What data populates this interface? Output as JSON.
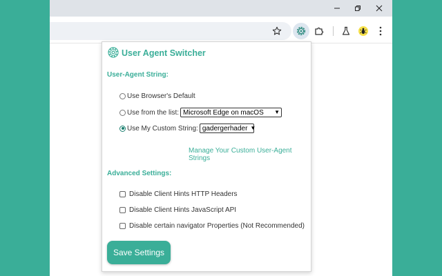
{
  "colors": {
    "accent": "#3aae98",
    "background": "#3aae98"
  },
  "browser": {
    "controls": [
      "minimize-icon",
      "restore-icon",
      "close-icon"
    ],
    "toolbar_icons": [
      "star-icon",
      "gear-icon",
      "puzzle-icon",
      "flask-icon",
      "bug-icon",
      "kebab-menu-icon"
    ]
  },
  "popup": {
    "title": "User Agent Switcher",
    "ua_section": "User-Agent String:",
    "options": {
      "default_label": "Use Browser's Default",
      "list_label": "Use from the list:",
      "list_value": "Microsoft Edge on macOS",
      "custom_label": "Use My Custom String:",
      "custom_value": "gadergerhader"
    },
    "manage_link": "Manage Your Custom User-Agent Strings",
    "advanced_section": "Advanced Settings:",
    "advanced": {
      "hints_headers": "Disable Client Hints HTTP Headers",
      "hints_js": "Disable Client Hints JavaScript API",
      "navigator_props": "Disable certain navigator Properties (Not Recommended)"
    },
    "save_label": "Save Settings"
  }
}
